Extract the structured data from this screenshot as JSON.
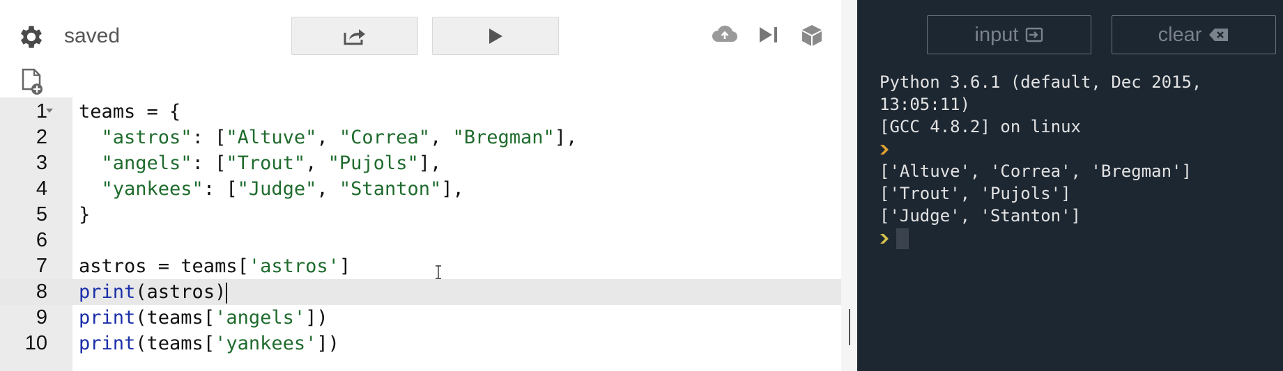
{
  "toolbar": {
    "status": "saved"
  },
  "editor": {
    "lines": [
      {
        "num": "1",
        "parts": [
          {
            "t": "teams = {",
            "c": "plain"
          }
        ]
      },
      {
        "num": "2",
        "parts": [
          {
            "t": "  ",
            "c": "plain"
          },
          {
            "t": "\"astros\"",
            "c": "str"
          },
          {
            "t": ": [",
            "c": "plain"
          },
          {
            "t": "\"Altuve\"",
            "c": "str"
          },
          {
            "t": ", ",
            "c": "plain"
          },
          {
            "t": "\"Correa\"",
            "c": "str"
          },
          {
            "t": ", ",
            "c": "plain"
          },
          {
            "t": "\"Bregman\"",
            "c": "str"
          },
          {
            "t": "],",
            "c": "plain"
          }
        ]
      },
      {
        "num": "3",
        "parts": [
          {
            "t": "  ",
            "c": "plain"
          },
          {
            "t": "\"angels\"",
            "c": "str"
          },
          {
            "t": ": [",
            "c": "plain"
          },
          {
            "t": "\"Trout\"",
            "c": "str"
          },
          {
            "t": ", ",
            "c": "plain"
          },
          {
            "t": "\"Pujols\"",
            "c": "str"
          },
          {
            "t": "],",
            "c": "plain"
          }
        ]
      },
      {
        "num": "4",
        "parts": [
          {
            "t": "  ",
            "c": "plain"
          },
          {
            "t": "\"yankees\"",
            "c": "str"
          },
          {
            "t": ": [",
            "c": "plain"
          },
          {
            "t": "\"Judge\"",
            "c": "str"
          },
          {
            "t": ", ",
            "c": "plain"
          },
          {
            "t": "\"Stanton\"",
            "c": "str"
          },
          {
            "t": "],",
            "c": "plain"
          }
        ]
      },
      {
        "num": "5",
        "parts": [
          {
            "t": "}",
            "c": "plain"
          }
        ]
      },
      {
        "num": "6",
        "parts": []
      },
      {
        "num": "7",
        "parts": [
          {
            "t": "astros = teams[",
            "c": "plain"
          },
          {
            "t": "'astros'",
            "c": "str"
          },
          {
            "t": "]",
            "c": "plain"
          }
        ]
      },
      {
        "num": "8",
        "parts": [
          {
            "t": "print",
            "c": "kw"
          },
          {
            "t": "(astros)",
            "c": "plain"
          }
        ],
        "active": true
      },
      {
        "num": "9",
        "parts": [
          {
            "t": "print",
            "c": "kw"
          },
          {
            "t": "(teams[",
            "c": "plain"
          },
          {
            "t": "'angels'",
            "c": "str"
          },
          {
            "t": "])",
            "c": "plain"
          }
        ]
      },
      {
        "num": "10",
        "parts": [
          {
            "t": "print",
            "c": "kw"
          },
          {
            "t": "(teams[",
            "c": "plain"
          },
          {
            "t": "'yankees'",
            "c": "str"
          },
          {
            "t": "])",
            "c": "plain"
          }
        ]
      }
    ]
  },
  "console": {
    "input_label": "input",
    "clear_label": "clear",
    "lines": [
      {
        "text": "Python 3.6.1 (default, Dec 2015,"
      },
      {
        "text": "13:05:11)"
      },
      {
        "text": "[GCC 4.8.2] on linux"
      },
      {
        "text": "",
        "prompt": true
      },
      {
        "text": "['Altuve', 'Correa', 'Bregman']"
      },
      {
        "text": "['Trout', 'Pujols']"
      },
      {
        "text": "['Judge', 'Stanton']"
      },
      {
        "text": "",
        "prompt": true,
        "cursor": true
      }
    ]
  },
  "colors": {
    "console_bg": "#1d2732",
    "string": "#1f6b2d",
    "keyword": "#1a2fa8",
    "prompt": "#e0a030"
  },
  "icons": [
    "gear-icon",
    "share-icon",
    "play-icon",
    "cloud-upload-icon",
    "step-icon",
    "package-icon",
    "new-file-icon",
    "input-icon",
    "backspace-icon"
  ]
}
